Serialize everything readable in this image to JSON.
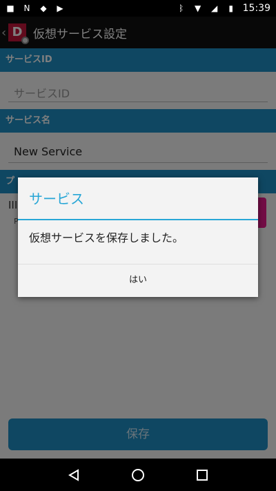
{
  "status_bar": {
    "time": "15:39",
    "icons_left": [
      "status-icon-a",
      "n-icon",
      "cat-icon",
      "arrow-icon"
    ],
    "icons_right": [
      "bluetooth-icon",
      "wifi-icon",
      "signal-icon",
      "battery-icon"
    ]
  },
  "app_bar": {
    "logo_letter": "D",
    "title": "仮想サービス設定"
  },
  "form": {
    "service_id_header": "サービスID",
    "service_id_placeholder": "サービスID",
    "service_name_header": "サービス名",
    "service_name_value": "New Service",
    "plugin_header": "プ",
    "plugin_icon_text": "III",
    "plugin_sub": "P"
  },
  "save_button": "保存",
  "dialog": {
    "title": "サービス",
    "message": "仮想サービスを保存しました。",
    "ok_label": "はい"
  },
  "colors": {
    "accent": "#1e8fc5",
    "dialog_accent": "#27a6d6",
    "logo": "#c2173a",
    "pink": "#e61b8c"
  }
}
